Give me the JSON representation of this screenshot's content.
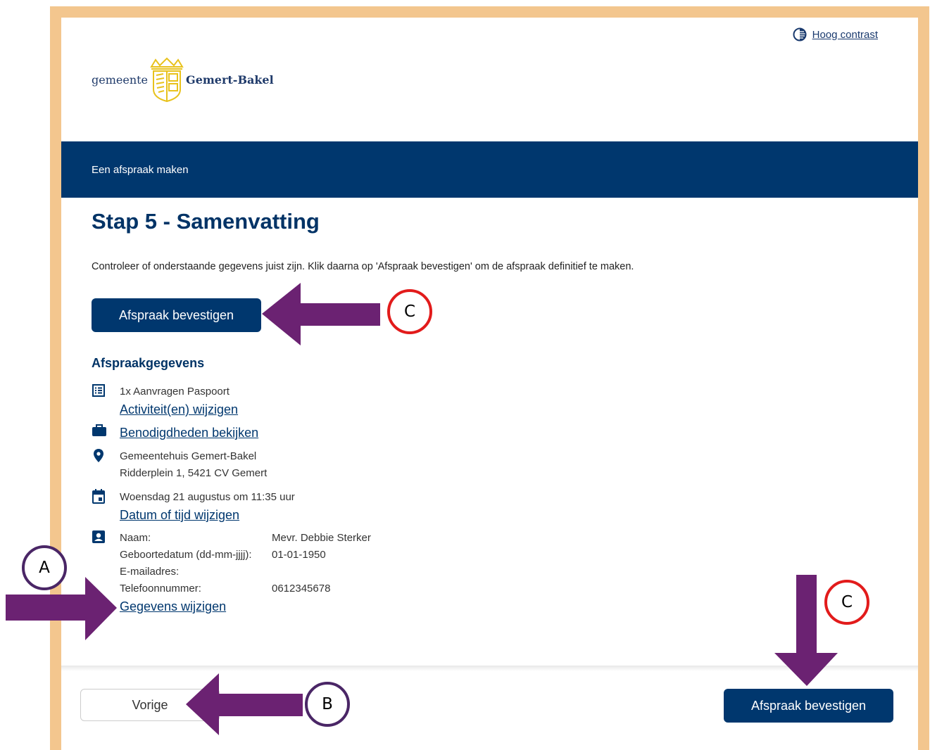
{
  "header": {
    "contrast_label": "Hoog contrast",
    "logo_prefix": "gemeente",
    "logo_name": "Gemert-Bakel"
  },
  "banner": {
    "title": "Een afspraak maken"
  },
  "main": {
    "heading": "Stap 5 - Samenvatting",
    "intro": "Controleer of onderstaande gegevens juist zijn. Klik daarna op 'Afspraak bevestigen' om de afspraak definitief te maken.",
    "confirm_label": "Afspraak bevestigen",
    "section_title": "Afspraakgegevens",
    "activity": "1x Aanvragen Paspoort",
    "activity_link": "Activiteit(en) wijzigen",
    "requirements_link": "Benodigdheden bekijken",
    "location_name": "Gemeentehuis Gemert-Bakel",
    "location_address": "Ridderplein 1, 5421 CV Gemert",
    "datetime": "Woensdag 21 augustus om 11:35 uur",
    "datetime_link": "Datum of tijd wijzigen",
    "details": {
      "name_label": "Naam:",
      "name_value": "Mevr. Debbie Sterker",
      "dob_label": "Geboortedatum (dd-mm-jjjj):",
      "dob_value": "01-01-1950",
      "email_label": "E-mailadres:",
      "email_value": "",
      "phone_label": "Telefoonnummer:",
      "phone_value": "0612345678"
    },
    "details_link": "Gegevens wijzigen"
  },
  "footer": {
    "prev_label": "Vorige",
    "confirm_label": "Afspraak bevestigen"
  },
  "annotations": {
    "a": "A",
    "b": "B",
    "c1": "C",
    "c2": "C"
  },
  "colors": {
    "frame": "#f3c68e",
    "navy": "#00376e",
    "arrow": "#6b2272",
    "red_circle": "#e21b1b"
  }
}
